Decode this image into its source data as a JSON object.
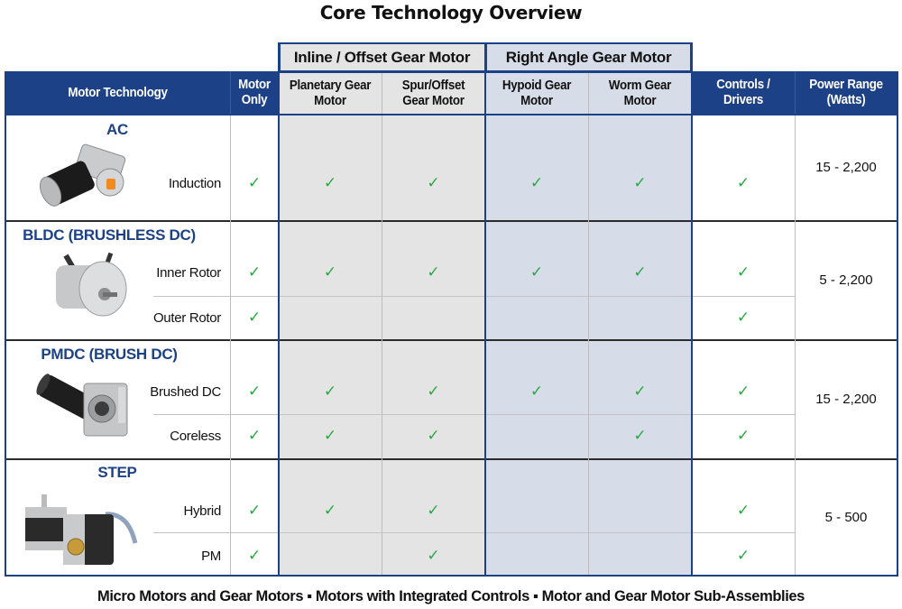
{
  "title": "Core Technology Overview",
  "header": {
    "group_inline": "Inline / Offset Gear Motor",
    "group_right_angle": "Right Angle Gear Motor",
    "columns": {
      "motor_technology": "Motor Technology",
      "motor_only_1": "Motor",
      "motor_only_2": "Only",
      "planetary_1": "Planetary Gear",
      "planetary_2": "Motor",
      "spur_1": "Spur/Offset",
      "spur_2": "Gear Motor",
      "hypoid_1": "Hypoid Gear",
      "hypoid_2": "Motor",
      "worm_1": "Worm Gear",
      "worm_2": "Motor",
      "controls_1": "Controls /",
      "controls_2": "Drivers",
      "power_1": "Power Range",
      "power_2": "(Watts)"
    }
  },
  "check_glyph": "✓",
  "colors": {
    "navy": "#1d4187",
    "check_green": "#2aa844",
    "inline_bg": "#e4e4e4",
    "right_angle_bg": "#d6dde8"
  },
  "categories": [
    {
      "name": "AC",
      "image": "ac-induction-gear-motor-image",
      "power_range": "15 - 2,200",
      "rows": [
        {
          "type": "Induction",
          "motor_only": true,
          "planetary": true,
          "spur": true,
          "hypoid": true,
          "worm": true,
          "controls": true
        }
      ]
    },
    {
      "name": "BLDC (BRUSHLESS DC)",
      "image": "bldc-motor-image",
      "power_range": "5 - 2,200",
      "rows": [
        {
          "type": "Inner Rotor",
          "motor_only": true,
          "planetary": true,
          "spur": true,
          "hypoid": true,
          "worm": true,
          "controls": true
        },
        {
          "type": "Outer Rotor",
          "motor_only": true,
          "planetary": false,
          "spur": false,
          "hypoid": false,
          "worm": false,
          "controls": true
        }
      ]
    },
    {
      "name": "PMDC (BRUSH DC)",
      "image": "pmdc-gear-motor-image",
      "power_range": "15 - 2,200",
      "rows": [
        {
          "type": "Brushed DC",
          "motor_only": true,
          "planetary": true,
          "spur": true,
          "hypoid": true,
          "worm": true,
          "controls": true
        },
        {
          "type": "Coreless",
          "motor_only": true,
          "planetary": true,
          "spur": true,
          "hypoid": false,
          "worm": true,
          "controls": true
        }
      ]
    },
    {
      "name": "STEP",
      "image": "stepper-motor-image",
      "power_range": "5 - 500",
      "rows": [
        {
          "type": "Hybrid",
          "motor_only": true,
          "planetary": true,
          "spur": true,
          "hypoid": false,
          "worm": false,
          "controls": true
        },
        {
          "type": "PM",
          "motor_only": true,
          "planetary": false,
          "spur": true,
          "hypoid": false,
          "worm": false,
          "controls": true
        }
      ]
    }
  ],
  "footer": "Micro Motors and Gear Motors ▪ Motors with Integrated Controls ▪ Motor and Gear Motor Sub-Assemblies"
}
